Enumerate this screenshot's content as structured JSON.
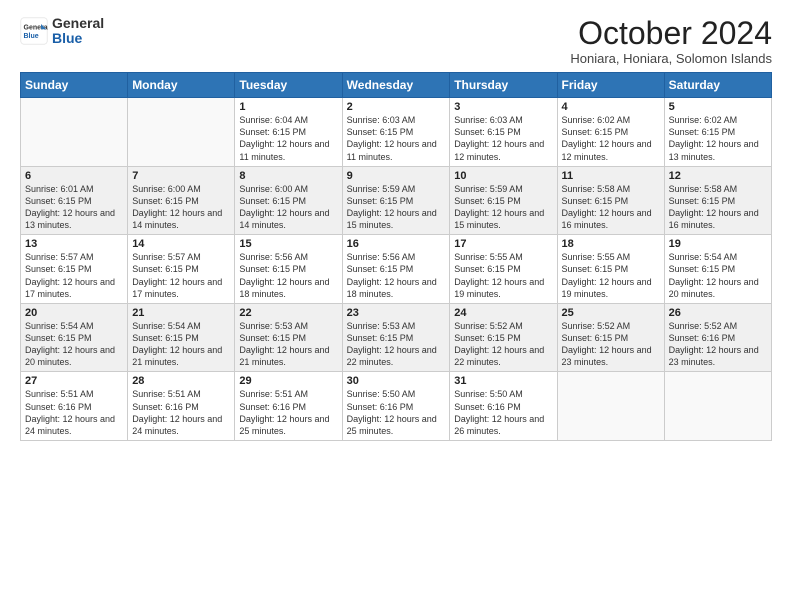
{
  "logo": {
    "general": "General",
    "blue": "Blue"
  },
  "title": "October 2024",
  "subtitle": "Honiara, Honiara, Solomon Islands",
  "days_of_week": [
    "Sunday",
    "Monday",
    "Tuesday",
    "Wednesday",
    "Thursday",
    "Friday",
    "Saturday"
  ],
  "weeks": [
    [
      {
        "day": "",
        "info": ""
      },
      {
        "day": "",
        "info": ""
      },
      {
        "day": "1",
        "info": "Sunrise: 6:04 AM\nSunset: 6:15 PM\nDaylight: 12 hours and 11 minutes."
      },
      {
        "day": "2",
        "info": "Sunrise: 6:03 AM\nSunset: 6:15 PM\nDaylight: 12 hours and 11 minutes."
      },
      {
        "day": "3",
        "info": "Sunrise: 6:03 AM\nSunset: 6:15 PM\nDaylight: 12 hours and 12 minutes."
      },
      {
        "day": "4",
        "info": "Sunrise: 6:02 AM\nSunset: 6:15 PM\nDaylight: 12 hours and 12 minutes."
      },
      {
        "day": "5",
        "info": "Sunrise: 6:02 AM\nSunset: 6:15 PM\nDaylight: 12 hours and 13 minutes."
      }
    ],
    [
      {
        "day": "6",
        "info": "Sunrise: 6:01 AM\nSunset: 6:15 PM\nDaylight: 12 hours and 13 minutes."
      },
      {
        "day": "7",
        "info": "Sunrise: 6:00 AM\nSunset: 6:15 PM\nDaylight: 12 hours and 14 minutes."
      },
      {
        "day": "8",
        "info": "Sunrise: 6:00 AM\nSunset: 6:15 PM\nDaylight: 12 hours and 14 minutes."
      },
      {
        "day": "9",
        "info": "Sunrise: 5:59 AM\nSunset: 6:15 PM\nDaylight: 12 hours and 15 minutes."
      },
      {
        "day": "10",
        "info": "Sunrise: 5:59 AM\nSunset: 6:15 PM\nDaylight: 12 hours and 15 minutes."
      },
      {
        "day": "11",
        "info": "Sunrise: 5:58 AM\nSunset: 6:15 PM\nDaylight: 12 hours and 16 minutes."
      },
      {
        "day": "12",
        "info": "Sunrise: 5:58 AM\nSunset: 6:15 PM\nDaylight: 12 hours and 16 minutes."
      }
    ],
    [
      {
        "day": "13",
        "info": "Sunrise: 5:57 AM\nSunset: 6:15 PM\nDaylight: 12 hours and 17 minutes."
      },
      {
        "day": "14",
        "info": "Sunrise: 5:57 AM\nSunset: 6:15 PM\nDaylight: 12 hours and 17 minutes."
      },
      {
        "day": "15",
        "info": "Sunrise: 5:56 AM\nSunset: 6:15 PM\nDaylight: 12 hours and 18 minutes."
      },
      {
        "day": "16",
        "info": "Sunrise: 5:56 AM\nSunset: 6:15 PM\nDaylight: 12 hours and 18 minutes."
      },
      {
        "day": "17",
        "info": "Sunrise: 5:55 AM\nSunset: 6:15 PM\nDaylight: 12 hours and 19 minutes."
      },
      {
        "day": "18",
        "info": "Sunrise: 5:55 AM\nSunset: 6:15 PM\nDaylight: 12 hours and 19 minutes."
      },
      {
        "day": "19",
        "info": "Sunrise: 5:54 AM\nSunset: 6:15 PM\nDaylight: 12 hours and 20 minutes."
      }
    ],
    [
      {
        "day": "20",
        "info": "Sunrise: 5:54 AM\nSunset: 6:15 PM\nDaylight: 12 hours and 20 minutes."
      },
      {
        "day": "21",
        "info": "Sunrise: 5:54 AM\nSunset: 6:15 PM\nDaylight: 12 hours and 21 minutes."
      },
      {
        "day": "22",
        "info": "Sunrise: 5:53 AM\nSunset: 6:15 PM\nDaylight: 12 hours and 21 minutes."
      },
      {
        "day": "23",
        "info": "Sunrise: 5:53 AM\nSunset: 6:15 PM\nDaylight: 12 hours and 22 minutes."
      },
      {
        "day": "24",
        "info": "Sunrise: 5:52 AM\nSunset: 6:15 PM\nDaylight: 12 hours and 22 minutes."
      },
      {
        "day": "25",
        "info": "Sunrise: 5:52 AM\nSunset: 6:15 PM\nDaylight: 12 hours and 23 minutes."
      },
      {
        "day": "26",
        "info": "Sunrise: 5:52 AM\nSunset: 6:16 PM\nDaylight: 12 hours and 23 minutes."
      }
    ],
    [
      {
        "day": "27",
        "info": "Sunrise: 5:51 AM\nSunset: 6:16 PM\nDaylight: 12 hours and 24 minutes."
      },
      {
        "day": "28",
        "info": "Sunrise: 5:51 AM\nSunset: 6:16 PM\nDaylight: 12 hours and 24 minutes."
      },
      {
        "day": "29",
        "info": "Sunrise: 5:51 AM\nSunset: 6:16 PM\nDaylight: 12 hours and 25 minutes."
      },
      {
        "day": "30",
        "info": "Sunrise: 5:50 AM\nSunset: 6:16 PM\nDaylight: 12 hours and 25 minutes."
      },
      {
        "day": "31",
        "info": "Sunrise: 5:50 AM\nSunset: 6:16 PM\nDaylight: 12 hours and 26 minutes."
      },
      {
        "day": "",
        "info": ""
      },
      {
        "day": "",
        "info": ""
      }
    ]
  ]
}
